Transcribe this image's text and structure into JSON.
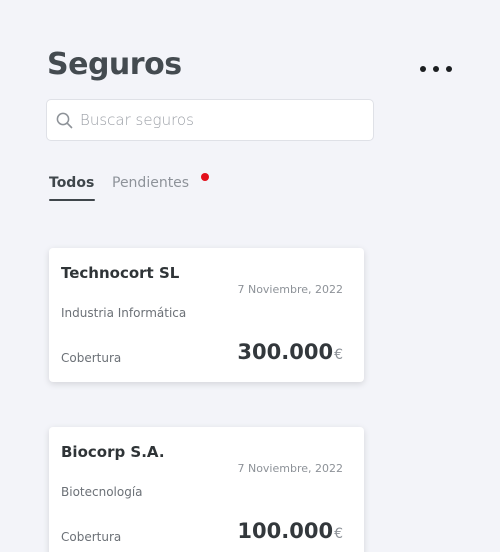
{
  "header": {
    "title": "Seguros",
    "more_icon": "more-horizontal-icon"
  },
  "search": {
    "placeholder": "Buscar seguros",
    "value": "",
    "icon": "search-icon"
  },
  "tabs": [
    {
      "label": "Todos",
      "active": true
    },
    {
      "label": "Pendientes",
      "active": false,
      "has_notification": true
    }
  ],
  "colors": {
    "background": "#f3f4f9",
    "notification": "#e30f1b",
    "title": "#444b50"
  },
  "policies": [
    {
      "company": "Technocort SL",
      "date": "7 Noviembre, 2022",
      "sector": "Industria Informática",
      "coverage_label": "Cobertura",
      "coverage_amount": "300.000",
      "currency": "€"
    },
    {
      "company": "Biocorp S.A.",
      "date": "7 Noviembre, 2022",
      "sector": "Biotecnología",
      "coverage_label": "Cobertura",
      "coverage_amount": "100.000",
      "currency": "€"
    }
  ]
}
